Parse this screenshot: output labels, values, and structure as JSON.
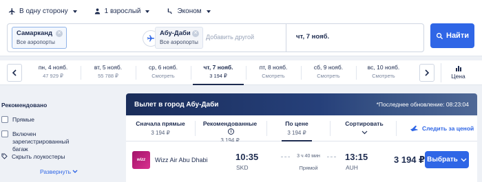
{
  "search": {
    "trip_type": "В одну сторону",
    "passengers": "1 взрослый",
    "cabin": "Эконом",
    "from_city": "Самарканд",
    "from_airports": "Все аэропорты",
    "to_city": "Абу-Даби",
    "to_airports": "Все аэропорты",
    "add_other": "Добавить другой",
    "date": "чт, 7 нояб.",
    "find_label": "Найти"
  },
  "dates": {
    "days": [
      {
        "label": "пн, 4 нояб.",
        "price": "47 929 ₽"
      },
      {
        "label": "вт, 5 нояб.",
        "price": "55 788 ₽"
      },
      {
        "label": "ср, 6 нояб.",
        "price": "Смотреть"
      },
      {
        "label": "чт, 7 нояб.",
        "price": "3 194 ₽"
      },
      {
        "label": "пт, 8 нояб.",
        "price": "Смотреть"
      },
      {
        "label": "сб, 9 нояб.",
        "price": "Смотреть"
      },
      {
        "label": "вс, 10 нояб.",
        "price": "Смотреть"
      }
    ],
    "active_index": 3,
    "sort_label": "Цена"
  },
  "sidebar": {
    "title": "Рекомендовано",
    "items": [
      {
        "label": "Прямые"
      },
      {
        "label": "Включен зарегистрированный багаж"
      },
      {
        "label": "Скрыть лоукостеры"
      }
    ],
    "expand_label": "Развернуть"
  },
  "results": {
    "banner_title": "Вылет в город Абу-Даби",
    "updated": "*Последнее обновление: 08:23:04",
    "tabs": [
      {
        "label": "Сначала прямые",
        "value": "3 194 ₽"
      },
      {
        "label": "Рекомендованные",
        "value": "3 194 ₽"
      },
      {
        "label": "По цене",
        "value": "3 194 ₽"
      },
      {
        "label": "Сортировать",
        "value": ""
      }
    ],
    "follow_label": "Следить за ценой",
    "flight": {
      "logo_text": "wizz",
      "airline": "Wizz Air Abu Dhabi",
      "dep_time": "10:35",
      "dep_code": "SKD",
      "duration": "3 ч 40 мин",
      "stops": "Прямой",
      "arr_time": "13:15",
      "arr_code": "AUH",
      "price": "3 194 ₽",
      "choose_label": "Выбрать"
    }
  },
  "colors": {
    "accent": "#2f66e6",
    "text": "#1d2b4f",
    "banner": "#1a2d5a"
  }
}
